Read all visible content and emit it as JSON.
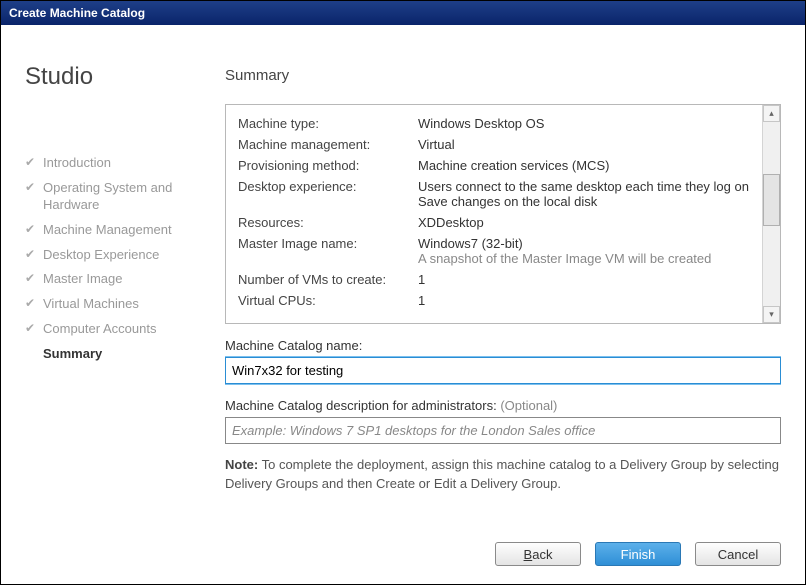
{
  "window": {
    "title": "Create Machine Catalog"
  },
  "sidebar": {
    "title": "Studio",
    "steps": [
      {
        "label": "Introduction",
        "done": true,
        "current": false
      },
      {
        "label": "Operating System and Hardware",
        "done": true,
        "current": false
      },
      {
        "label": "Machine Management",
        "done": true,
        "current": false
      },
      {
        "label": "Desktop Experience",
        "done": true,
        "current": false
      },
      {
        "label": "Master Image",
        "done": true,
        "current": false
      },
      {
        "label": "Virtual Machines",
        "done": true,
        "current": false
      },
      {
        "label": "Computer Accounts",
        "done": true,
        "current": false
      },
      {
        "label": "Summary",
        "done": false,
        "current": true
      }
    ]
  },
  "heading": "Summary",
  "summary": {
    "machine_type": {
      "k": "Machine type:",
      "v": "Windows Desktop OS"
    },
    "machine_management": {
      "k": "Machine management:",
      "v": "Virtual"
    },
    "provisioning": {
      "k": "Provisioning method:",
      "v": "Machine creation services (MCS)"
    },
    "desktop_experience": {
      "k": "Desktop experience:",
      "v1": "Users connect to the same desktop each time they log on",
      "v2": "Save changes on the local disk"
    },
    "resources": {
      "k": "Resources:",
      "v": "XDDesktop"
    },
    "master_image": {
      "k": "Master Image name:",
      "v": "Windows7 (32-bit)",
      "sub": "A snapshot of the Master Image VM will be created"
    },
    "num_vms": {
      "k": "Number of VMs to create:",
      "v": "1"
    },
    "vcpus": {
      "k": "Virtual CPUs:",
      "v": "1"
    }
  },
  "fields": {
    "name_label": "Machine Catalog name:",
    "name_value": "Win7x32 for testing",
    "desc_label": "Machine Catalog description for administrators:",
    "desc_optional": "(Optional)",
    "desc_placeholder": "Example: Windows 7 SP1 desktops for the London Sales office",
    "desc_value": ""
  },
  "note": {
    "prefix": "Note:",
    "text": " To complete the deployment, assign this machine catalog to a Delivery Group by selecting Delivery Groups and then Create or Edit a Delivery Group."
  },
  "buttons": {
    "back": "Back",
    "finish": "Finish",
    "cancel": "Cancel"
  }
}
